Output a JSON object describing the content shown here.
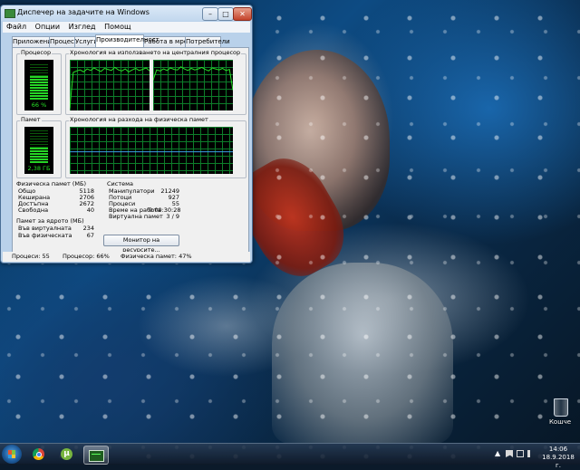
{
  "window": {
    "title": "Диспечер на задачите на Windows",
    "menu": [
      "Файл",
      "Опции",
      "Изглед",
      "Помощ"
    ],
    "tabs": [
      "Приложения",
      "Процеси",
      "Услуги",
      "Производителност",
      "Работа в мрежа",
      "Потребители"
    ],
    "active_tab": "Производителност",
    "cpu": {
      "label": "Процесор",
      "value": "66 %",
      "level": 0.66,
      "history_label": "Хронология на използването на централния процесор"
    },
    "memory": {
      "label": "Памет",
      "value": "2,38 ГБ",
      "level": 0.47,
      "history_label": "Хронология на разхода на физическа памет"
    },
    "physical_memory": {
      "header": "Физическа памет (МБ)",
      "rows": [
        {
          "label": "Общо",
          "value": "5118"
        },
        {
          "label": "Кеширана",
          "value": "2706"
        },
        {
          "label": "Достъпна",
          "value": "2672"
        },
        {
          "label": "Свободна",
          "value": "40"
        }
      ]
    },
    "system": {
      "header": "Система",
      "rows": [
        {
          "label": "Манипулатори",
          "value": "21249"
        },
        {
          "label": "Потоци",
          "value": "927"
        },
        {
          "label": "Процеси",
          "value": "55"
        },
        {
          "label": "Време на работа",
          "value": "0:00:30:28"
        },
        {
          "label": "Виртуална памет",
          "value": "3 / 9"
        }
      ]
    },
    "kernel_memory": {
      "header": "Памет за ядрото (МБ)",
      "rows": [
        {
          "label": "Във виртуалната",
          "value": "234"
        },
        {
          "label": "Във физическата",
          "value": "67"
        }
      ]
    },
    "resource_monitor_button": "Монитор на ресурсите...",
    "status": {
      "processes": "Процеси: 55",
      "cpu": "Процесор: 66%",
      "memory": "Физическа памет: 47%"
    }
  },
  "desktop": {
    "recycle_bin_label": "Кошче"
  },
  "taskbar": {
    "clock_time": "14:06",
    "clock_date": "18.9.2018 г.",
    "pinned": [
      "windows-start-icon",
      "chrome-icon",
      "utorrent-icon",
      "task-manager-icon"
    ]
  },
  "graph_series": {
    "cpu_core1": [
      5,
      75,
      78,
      80,
      76,
      82,
      79,
      84,
      80,
      77,
      83,
      81,
      79,
      85,
      80,
      78,
      82,
      76,
      80,
      83,
      79,
      81,
      84,
      78
    ],
    "cpu_core2": [
      60,
      80,
      78,
      82,
      79,
      84,
      81,
      80,
      86,
      82,
      79,
      83,
      80,
      82,
      85,
      81,
      78,
      84,
      82,
      80,
      83,
      79,
      81,
      40
    ],
    "memory": [
      47,
      47,
      47,
      47,
      47,
      47,
      47,
      47,
      47,
      47,
      47,
      47,
      47,
      47,
      47,
      47,
      47,
      47,
      47,
      47,
      47,
      47,
      47,
      47
    ]
  },
  "colors": {
    "graph_line": "#27e027",
    "memory_line": "#3b9ee8",
    "window_frame": "#b9d1ea"
  }
}
